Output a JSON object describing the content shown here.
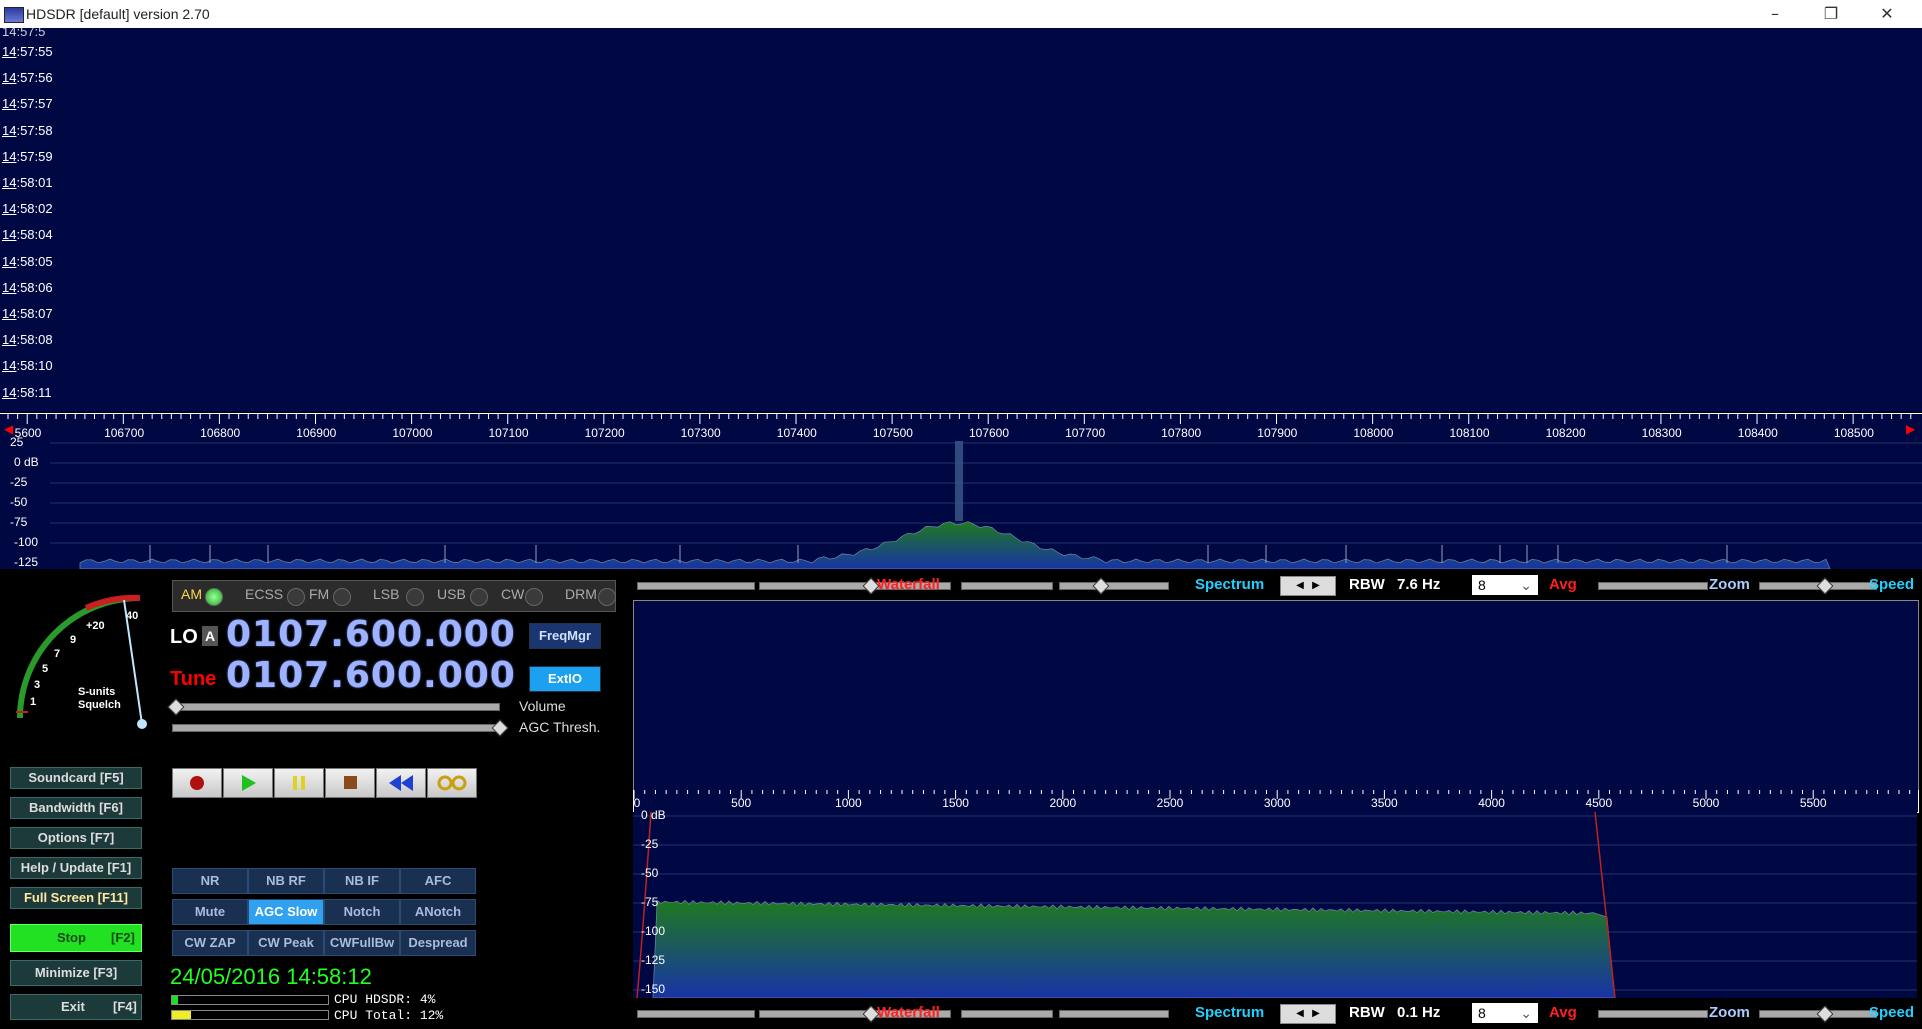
{
  "window": {
    "title": "HDSDR [default]  version 2.70",
    "controls": {
      "minimize": "–",
      "restore": "❐",
      "close": "✕"
    }
  },
  "waterfall": {
    "partial_top": "14:57:5",
    "timestamps": [
      {
        "hh": "14",
        "rest": ":57:55"
      },
      {
        "hh": "14",
        "rest": ":57:56"
      },
      {
        "hh": "14",
        "rest": ":57:57"
      },
      {
        "hh": "14",
        "rest": ":57:58"
      },
      {
        "hh": "14",
        "rest": ":57:59"
      },
      {
        "hh": "14",
        "rest": ":58:01"
      },
      {
        "hh": "14",
        "rest": ":58:02"
      },
      {
        "hh": "14",
        "rest": ":58:04"
      },
      {
        "hh": "14",
        "rest": ":58:05"
      },
      {
        "hh": "14",
        "rest": ":58:06"
      },
      {
        "hh": "14",
        "rest": ":58:07"
      },
      {
        "hh": "14",
        "rest": ":58:08"
      },
      {
        "hh": "14",
        "rest": ":58:10"
      },
      {
        "hh": "14",
        "rest": ":58:11"
      }
    ]
  },
  "rf_axis": {
    "labels": [
      "5600",
      "106700",
      "106800",
      "106900",
      "107000",
      "107100",
      "107200",
      "107300",
      "107400",
      "107500",
      "107600",
      "107700",
      "107800",
      "107900",
      "108000",
      "108100",
      "108200",
      "108300",
      "108400",
      "108500"
    ]
  },
  "rf_spectrum": {
    "db_labels": [
      "25",
      "0 dB",
      "-25",
      "-50",
      "-75",
      "-100",
      "-125"
    ]
  },
  "smeter": {
    "scale": [
      "1",
      "3",
      "5",
      "7",
      "9",
      "+20",
      "40"
    ],
    "line1": "S-units",
    "line2": "Squelch"
  },
  "modes": [
    {
      "label": "AM",
      "active": true
    },
    {
      "label": "ECSS",
      "active": false
    },
    {
      "label": "FM",
      "active": false
    },
    {
      "label": "LSB",
      "active": false
    },
    {
      "label": "USB",
      "active": false
    },
    {
      "label": "CW",
      "active": false
    },
    {
      "label": "DRM",
      "active": false
    }
  ],
  "frequency": {
    "lo_label": "LO",
    "lo_badge": "A",
    "lo_value": "0107.600.000",
    "tune_label": "Tune",
    "tune_value": "0107.600.000",
    "freqmgr": "FreqMgr",
    "extio": "ExtIO",
    "volume": "Volume",
    "agc_thresh": "AGC Thresh."
  },
  "menu": {
    "soundcard": "Soundcard  [F5]",
    "bandwidth": "Bandwidth  [F6]",
    "options": "Options   [F7]",
    "help": "Help / Update  [F1]",
    "fullscreen": "Full Screen  [F11]",
    "stop": "Stop",
    "stop_key": "[F2]",
    "minimize": "Minimize  [F3]",
    "exit": "Exit",
    "exit_key": "[F4]"
  },
  "dsp": [
    [
      "NR",
      "NB RF",
      "NB IF",
      "AFC"
    ],
    [
      "Mute",
      "AGC Slow",
      "Notch",
      "ANotch"
    ],
    [
      "CW ZAP",
      "CW Peak",
      "CWFullBw",
      "Despread"
    ]
  ],
  "status": {
    "datetime": "24/05/2016 14:58:12",
    "cpu_hdsdr": "CPU HDSDR: 4%",
    "cpu_total": "CPU Total: 12%",
    "cpu_hdsdr_pct": 4,
    "cpu_total_pct": 12
  },
  "controls_top": {
    "waterfall": "Waterfall",
    "spectrum": "Spectrum",
    "rbw_label": "RBW",
    "rbw_value": "7.6 Hz",
    "avg_value": "8",
    "avg": "Avg",
    "zoom": "Zoom",
    "speed": "Speed"
  },
  "controls_bottom": {
    "waterfall": "Waterfall",
    "spectrum": "Spectrum",
    "rbw_label": "RBW",
    "rbw_value": "0.1 Hz",
    "avg_value": "8",
    "avg": "Avg",
    "zoom": "Zoom",
    "speed": "Speed"
  },
  "af_axis": {
    "labels": [
      "0",
      "500",
      "1000",
      "1500",
      "2000",
      "2500",
      "3000",
      "3500",
      "4000",
      "4500",
      "5000",
      "5500"
    ]
  },
  "af_spectrum": {
    "db_labels": [
      "0 dB",
      "-25",
      "-50",
      "-75",
      "-100",
      "-125",
      "-150"
    ]
  },
  "colors": {
    "panel_bg": "#000844",
    "spectrum_fill_top": "#1e7a1e",
    "spectrum_fill_bottom": "#1833a6",
    "waterfall_label": "#ff2020",
    "spectrum_label": "#22d0ff",
    "stop_button": "#22e022"
  }
}
